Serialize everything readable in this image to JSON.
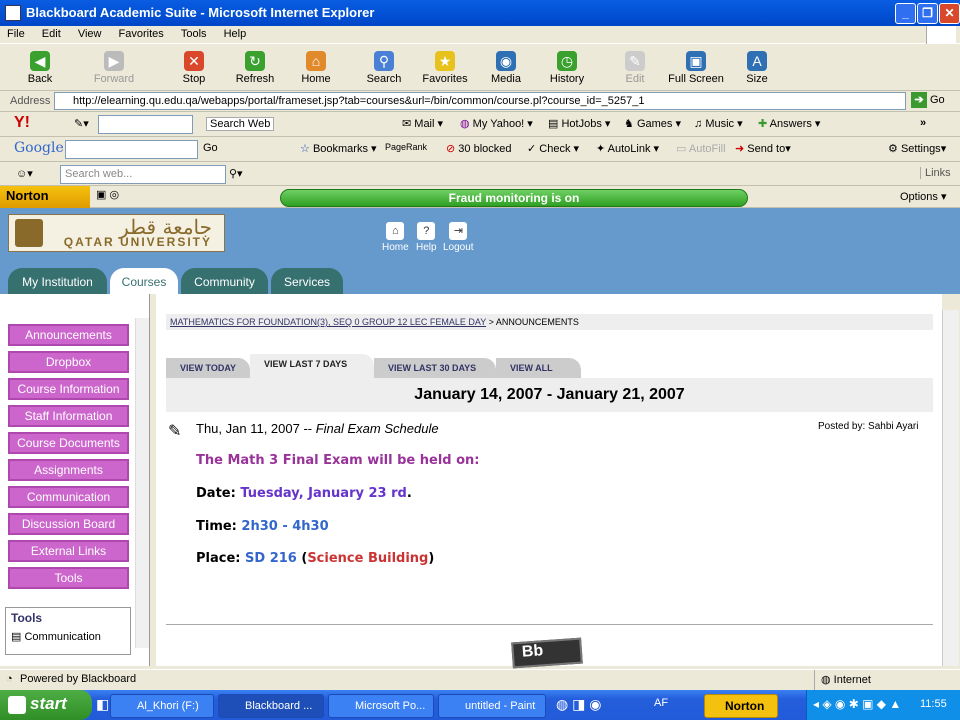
{
  "window": {
    "title": "Blackboard Academic Suite - Microsoft Internet Explorer"
  },
  "menu": [
    "File",
    "Edit",
    "View",
    "Favorites",
    "Tools",
    "Help"
  ],
  "toolbar": {
    "back": "Back",
    "forward": "Forward",
    "stop": "Stop",
    "refresh": "Refresh",
    "home": "Home",
    "search": "Search",
    "favorites": "Favorites",
    "media": "Media",
    "history": "History",
    "edit": "Edit",
    "fullscreen": "Full Screen",
    "size": "Size"
  },
  "address": {
    "label": "Address",
    "url": "http://elearning.qu.edu.qa/webapps/portal/frameset.jsp?tab=courses&url=/bin/common/course.pl?course_id=_5257_1",
    "go": "Go"
  },
  "yahoo_bar": {
    "search_web": "Search Web",
    "mail": "Mail",
    "my_yahoo": "My Yahoo!",
    "hotjobs": "HotJobs",
    "games": "Games",
    "music": "Music",
    "answers": "Answers"
  },
  "google_bar": {
    "go": "Go",
    "bookmarks": "Bookmarks",
    "pagerank": "PageRank",
    "blocked": "30 blocked",
    "check": "Check",
    "autolink": "AutoLink",
    "autofill": "AutoFill",
    "send_to": "Send to",
    "settings": "Settings"
  },
  "search_bar": {
    "placeholder": "Search web...",
    "links": "Links"
  },
  "norton": {
    "logo": "Norton",
    "fraud": "Fraud monitoring is on",
    "options": "Options"
  },
  "bb": {
    "logo_ar": "جامعة قطر",
    "logo_en": "QATAR UNIVERSITY",
    "home": "Home",
    "help": "Help",
    "logout": "Logout",
    "tabs": [
      "My Institution",
      "Courses",
      "Community",
      "Services"
    ],
    "nav": [
      "Announcements",
      "Dropbox",
      "Course Information",
      "Staff Information",
      "Course Documents",
      "Assignments",
      "Communication",
      "Discussion Board",
      "External Links",
      "Tools"
    ],
    "tools_title": "Tools",
    "tools_item": "Communication",
    "breadcrumb_link": "MATHEMATICS FOR FOUNDATION(3), SEQ 0 GROUP 12 LEC FEMALE DAY",
    "breadcrumb_tail": "> ANNOUNCEMENTS",
    "view_tabs": [
      "VIEW TODAY",
      "VIEW LAST 7 DAYS",
      "VIEW LAST 30 DAYS",
      "VIEW ALL"
    ],
    "date_range": "January 14, 2007 - January 21, 2007",
    "announcement": {
      "date": "Thu, Jan 11, 2007 -- ",
      "title": "Final Exam Schedule",
      "posted_by": "Posted by: Sahbi Ayari",
      "line1": "The Math 3 Final Exam will be  held on:",
      "date_label": "Date: ",
      "date_value": "Tuesday, January 23 rd",
      "date_end": ".",
      "time_label": "Time: ",
      "time_value": "2h30 - 4h30",
      "place_label": "Place: ",
      "place_value": "SD 216",
      "place_open": " (",
      "place_building": "Science Building",
      "place_close": ")"
    },
    "powered_by": "Powered by Blackboard"
  },
  "status": {
    "text": "Powered by Blackboard",
    "zone": "Internet"
  },
  "taskbar": {
    "start": "start",
    "tasks": [
      "Al_Khori (F:)",
      "Blackboard ...",
      "Microsoft Po...",
      "untitled - Paint"
    ],
    "af": "AF",
    "norton": "Norton",
    "clock": "11:55"
  },
  "colors": {
    "bb_blue": "#6699cc",
    "nav_pink": "#cc66cc",
    "tab_teal": "#36706f",
    "purple": "#993399",
    "violet": "#6633cc",
    "blue": "#3366cc",
    "red": "#cc3333"
  }
}
